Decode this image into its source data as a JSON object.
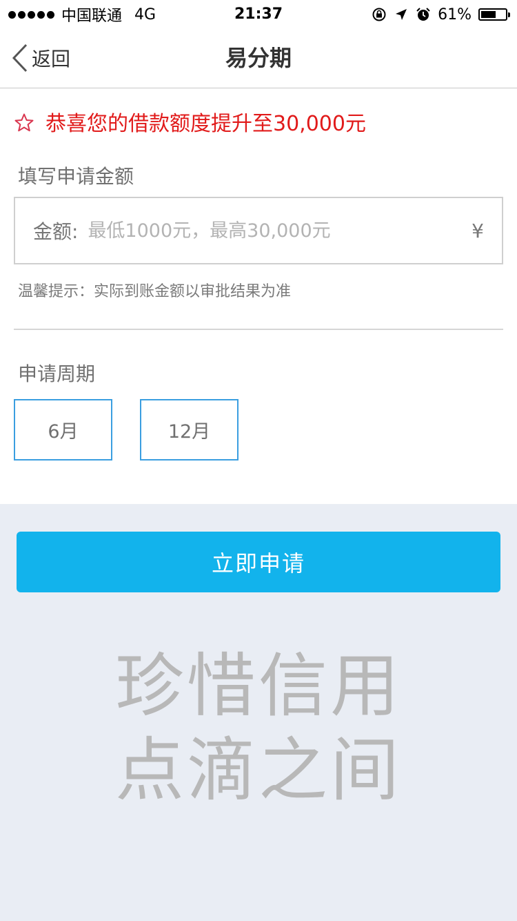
{
  "status_bar": {
    "carrier": "中国联通",
    "network": "4G",
    "time": "21:37",
    "battery_percent_label": "61%",
    "battery_level": 0.61,
    "icons": [
      "orientation-lock-icon",
      "location-arrow-icon",
      "alarm-icon",
      "battery-icon"
    ]
  },
  "nav": {
    "back_label": "返回",
    "title": "易分期"
  },
  "promo": {
    "text": "恭喜您的借款额度提升至30,000元",
    "icon": "star-outline-icon",
    "color": "#e11a1a"
  },
  "amount": {
    "section_label": "填写申请金额",
    "field_prefix": "金额:",
    "placeholder": "最低1000元，最高30,000元",
    "value": "",
    "currency_symbol": "¥",
    "tip": "温馨提示：实际到账金额以审批结果为准"
  },
  "period": {
    "section_label": "申请周期",
    "options": [
      "6月",
      "12月"
    ]
  },
  "apply_button": {
    "label": "立即申请",
    "color": "#12b3ec"
  },
  "slogan": {
    "line1": "珍惜信用",
    "line2": "点滴之间"
  }
}
